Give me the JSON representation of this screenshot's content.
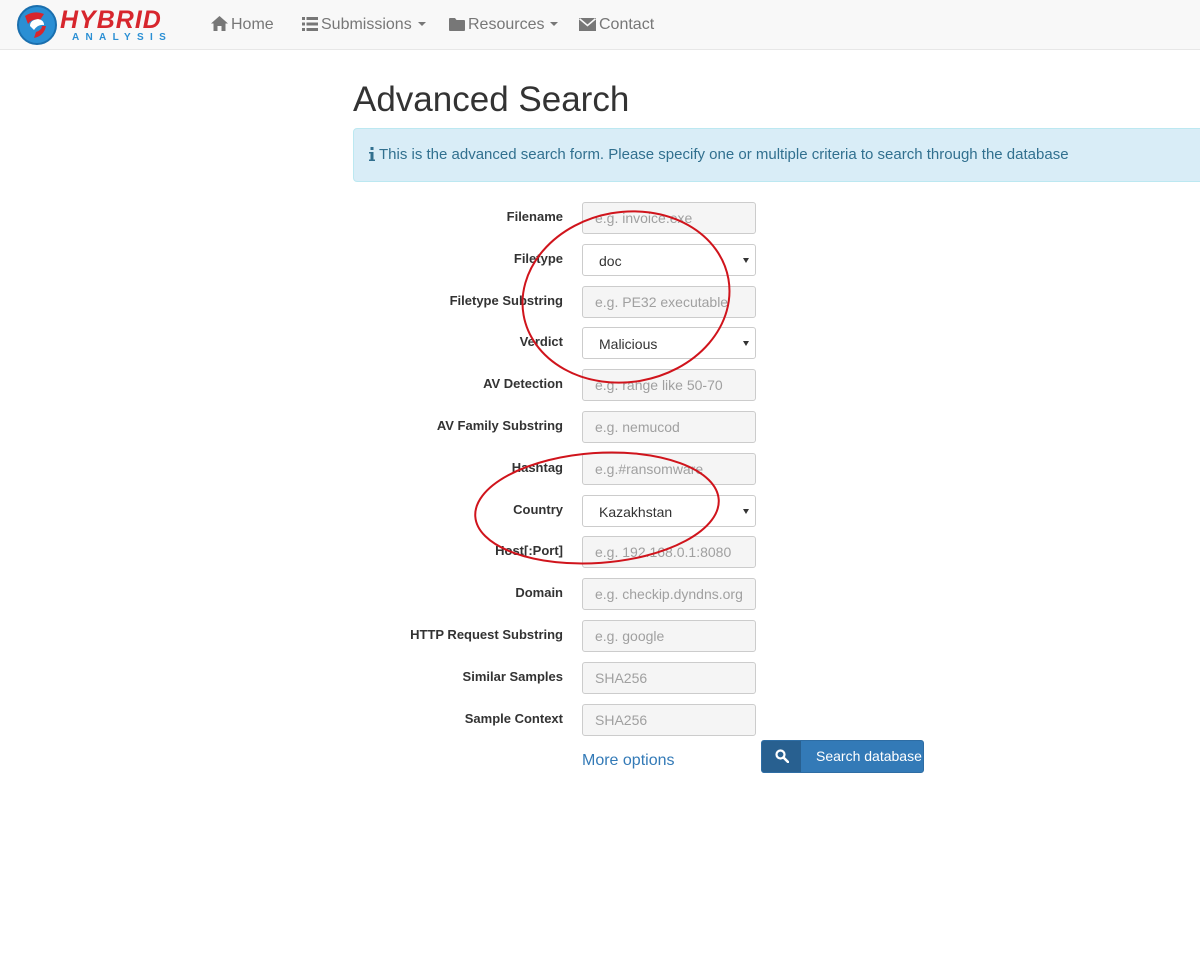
{
  "logo": {
    "line1": "HYBRID",
    "line2": "ANALYSIS"
  },
  "nav": {
    "home": "Home",
    "submissions": "Submissions",
    "resources": "Resources",
    "contact": "Contact"
  },
  "page": {
    "title": "Advanced Search",
    "info": "This is the advanced search form. Please specify one or multiple criteria to search through the database"
  },
  "form": {
    "filename": {
      "label": "Filename",
      "placeholder": "e.g. invoice.exe"
    },
    "filetype": {
      "label": "Filetype",
      "value": "doc"
    },
    "filetype_substring": {
      "label": "Filetype Substring",
      "placeholder": "e.g. PE32 executable"
    },
    "verdict": {
      "label": "Verdict",
      "value": "Malicious"
    },
    "av_detection": {
      "label": "AV Detection",
      "placeholder": "e.g. range like 50-70"
    },
    "av_family": {
      "label": "AV Family Substring",
      "placeholder": "e.g. nemucod"
    },
    "hashtag": {
      "label": "Hashtag",
      "placeholder": "e.g.#ransomware"
    },
    "country": {
      "label": "Country",
      "value": "Kazakhstan"
    },
    "host_port": {
      "label": "Host[:Port]",
      "placeholder": "e.g. 192.168.0.1:8080"
    },
    "domain": {
      "label": "Domain",
      "placeholder": "e.g. checkip.dyndns.org"
    },
    "http_request": {
      "label": "HTTP Request Substring",
      "placeholder": "e.g. google"
    },
    "similar_samples": {
      "label": "Similar Samples",
      "placeholder": "SHA256"
    },
    "sample_context": {
      "label": "Sample Context",
      "placeholder": "SHA256"
    }
  },
  "actions": {
    "more_options": "More options",
    "search": "Search database"
  },
  "colors": {
    "brand_red": "#d7262d",
    "brand_blue": "#2a8fd4",
    "primary": "#337ab7",
    "info_bg": "#d9edf7",
    "annotation_red": "#d0141c"
  },
  "icons": [
    "home-icon",
    "list-icon",
    "folder-icon",
    "envelope-icon",
    "info-icon",
    "search-icon"
  ]
}
